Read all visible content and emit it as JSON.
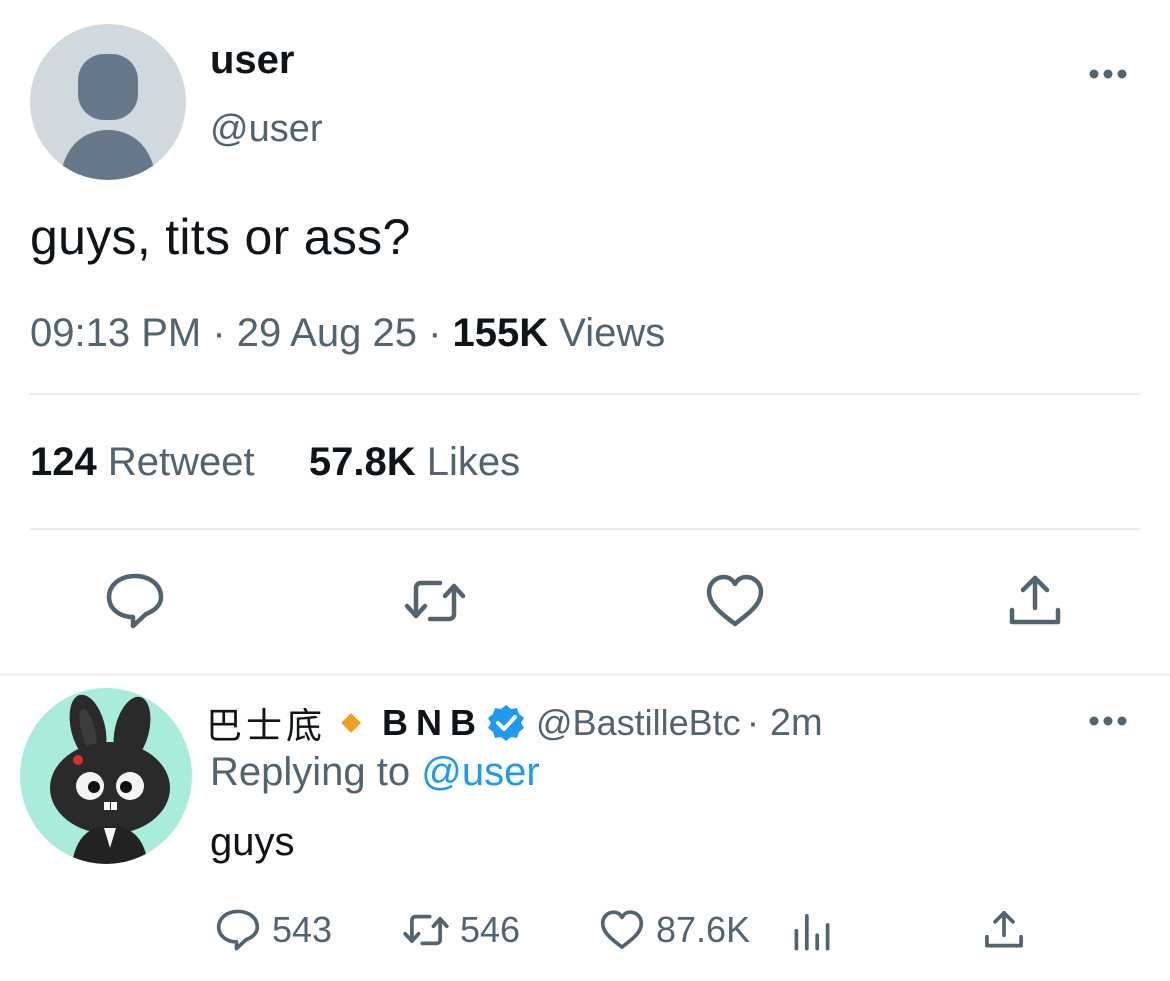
{
  "main_tweet": {
    "display_name": "user",
    "handle": "@user",
    "text": "guys, tits or ass?",
    "time": "09:13 PM",
    "date": "29 Aug 25",
    "views_count": "155K",
    "views_label": "Views",
    "retweet_count": "124",
    "retweet_label": "Retweet",
    "likes_count": "57.8K",
    "likes_label": "Likes"
  },
  "reply_tweet": {
    "display_name": "巴士底",
    "name_suffix": "BNB",
    "handle": "@BastilleBtc",
    "time": "· 2m",
    "replying_prefix": "Replying to",
    "replying_mention": "@user",
    "text": "guys",
    "reply_count": "543",
    "retweet_count": "546",
    "like_count": "87.6K"
  },
  "icons": {
    "reply": "comment-icon",
    "retweet": "retweet-icon",
    "like": "heart-icon",
    "share": "share-icon",
    "analytics": "analytics-icon",
    "more": "more-icon",
    "verified": "verified-badge-icon"
  },
  "colors": {
    "text_primary": "#0f1419",
    "text_secondary": "#536471",
    "accent_blue": "#1d9bf0",
    "diamond_orange": "#f0a020",
    "avatar_mint": "#a9ecdc"
  }
}
